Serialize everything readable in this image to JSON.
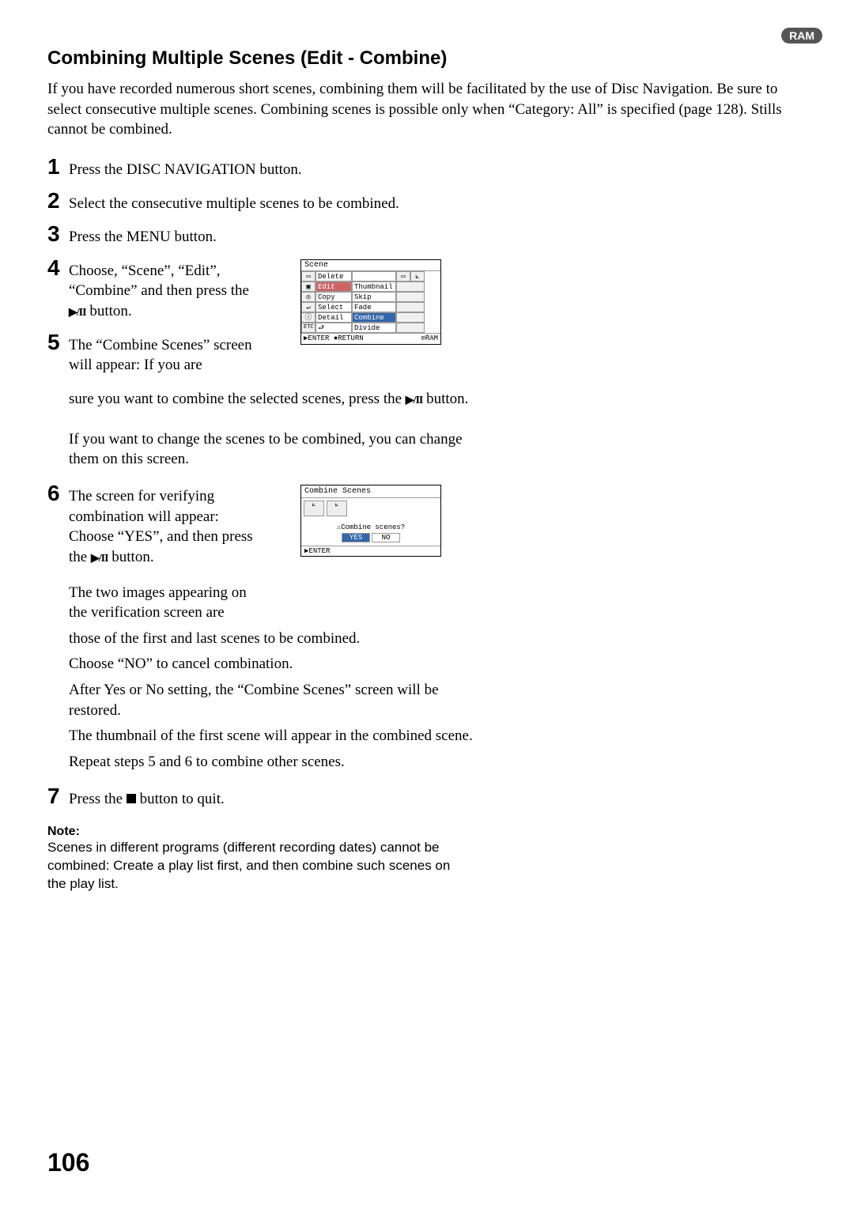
{
  "badge": "RAM",
  "title": "Combining Multiple Scenes (Edit - Combine)",
  "intro": "If you have recorded numerous short scenes, combining them will be facilitated by the use of Disc Navigation. Be sure to select consecutive multiple scenes. Combining scenes is possible only when “Category: All” is specified (page 128).  Stills cannot be combined.",
  "steps": {
    "s1": "Press the DISC NAVIGATION button.",
    "s2": "Select the consecutive multiple scenes to be combined.",
    "s3": "Press the MENU button.",
    "s4_a": "Choose, “Scene”, “Edit”, “Combine” and then press the ",
    "s4_b": " button.",
    "s5_a": "The “Combine Scenes” screen will appear: If you are sure you want to combine the selected scenes, press the ",
    "s5_b": " button.",
    "s5_c": "If you want to change the scenes to be combined, you can change them on this screen.",
    "s6_a": "The screen for verifying combination will appear: Choose “YES”, and then press the ",
    "s6_b": " button.",
    "s6_c": "The two images appearing on the verification screen are those of the first and last scenes to be combined.",
    "s6_d": "Choose “NO” to cancel combination.",
    "s6_e": "After Yes or No setting, the “Combine Scenes” screen will be restored.",
    "s6_f": "The thumbnail of the first scene will appear in the combined scene.",
    "s6_g": "Repeat steps 5 and 6 to combine other scenes.",
    "s7_a": "Press the ",
    "s7_b": " button to quit."
  },
  "note_label": "Note:",
  "note_text": "Scenes in different programs (different recording dates) cannot be combined: Create a play list first, and then combine such scenes on the play list.",
  "scene_menu": {
    "header": "Scene",
    "rows": [
      {
        "col1": "Delete",
        "col2": ""
      },
      {
        "col1": "Edit",
        "col2": "Thumbnail",
        "highlightCol1": true
      },
      {
        "col1": "Copy",
        "col2": "Skip"
      },
      {
        "col1": "Select",
        "col2": "Fade"
      },
      {
        "col1": "Detail",
        "col2": "Combine",
        "selectedCol2": true
      },
      {
        "col1": "",
        "col2": "Divide"
      }
    ],
    "footer_left": "▶ENTER  ●RETURN",
    "footer_right": "⊙RAM"
  },
  "combine_dialog": {
    "header": "Combine Scenes",
    "prompt": "⚠Combine scenes?",
    "yes": "YES",
    "no": "NO",
    "footer": "▶ENTER"
  },
  "page_number": "106"
}
